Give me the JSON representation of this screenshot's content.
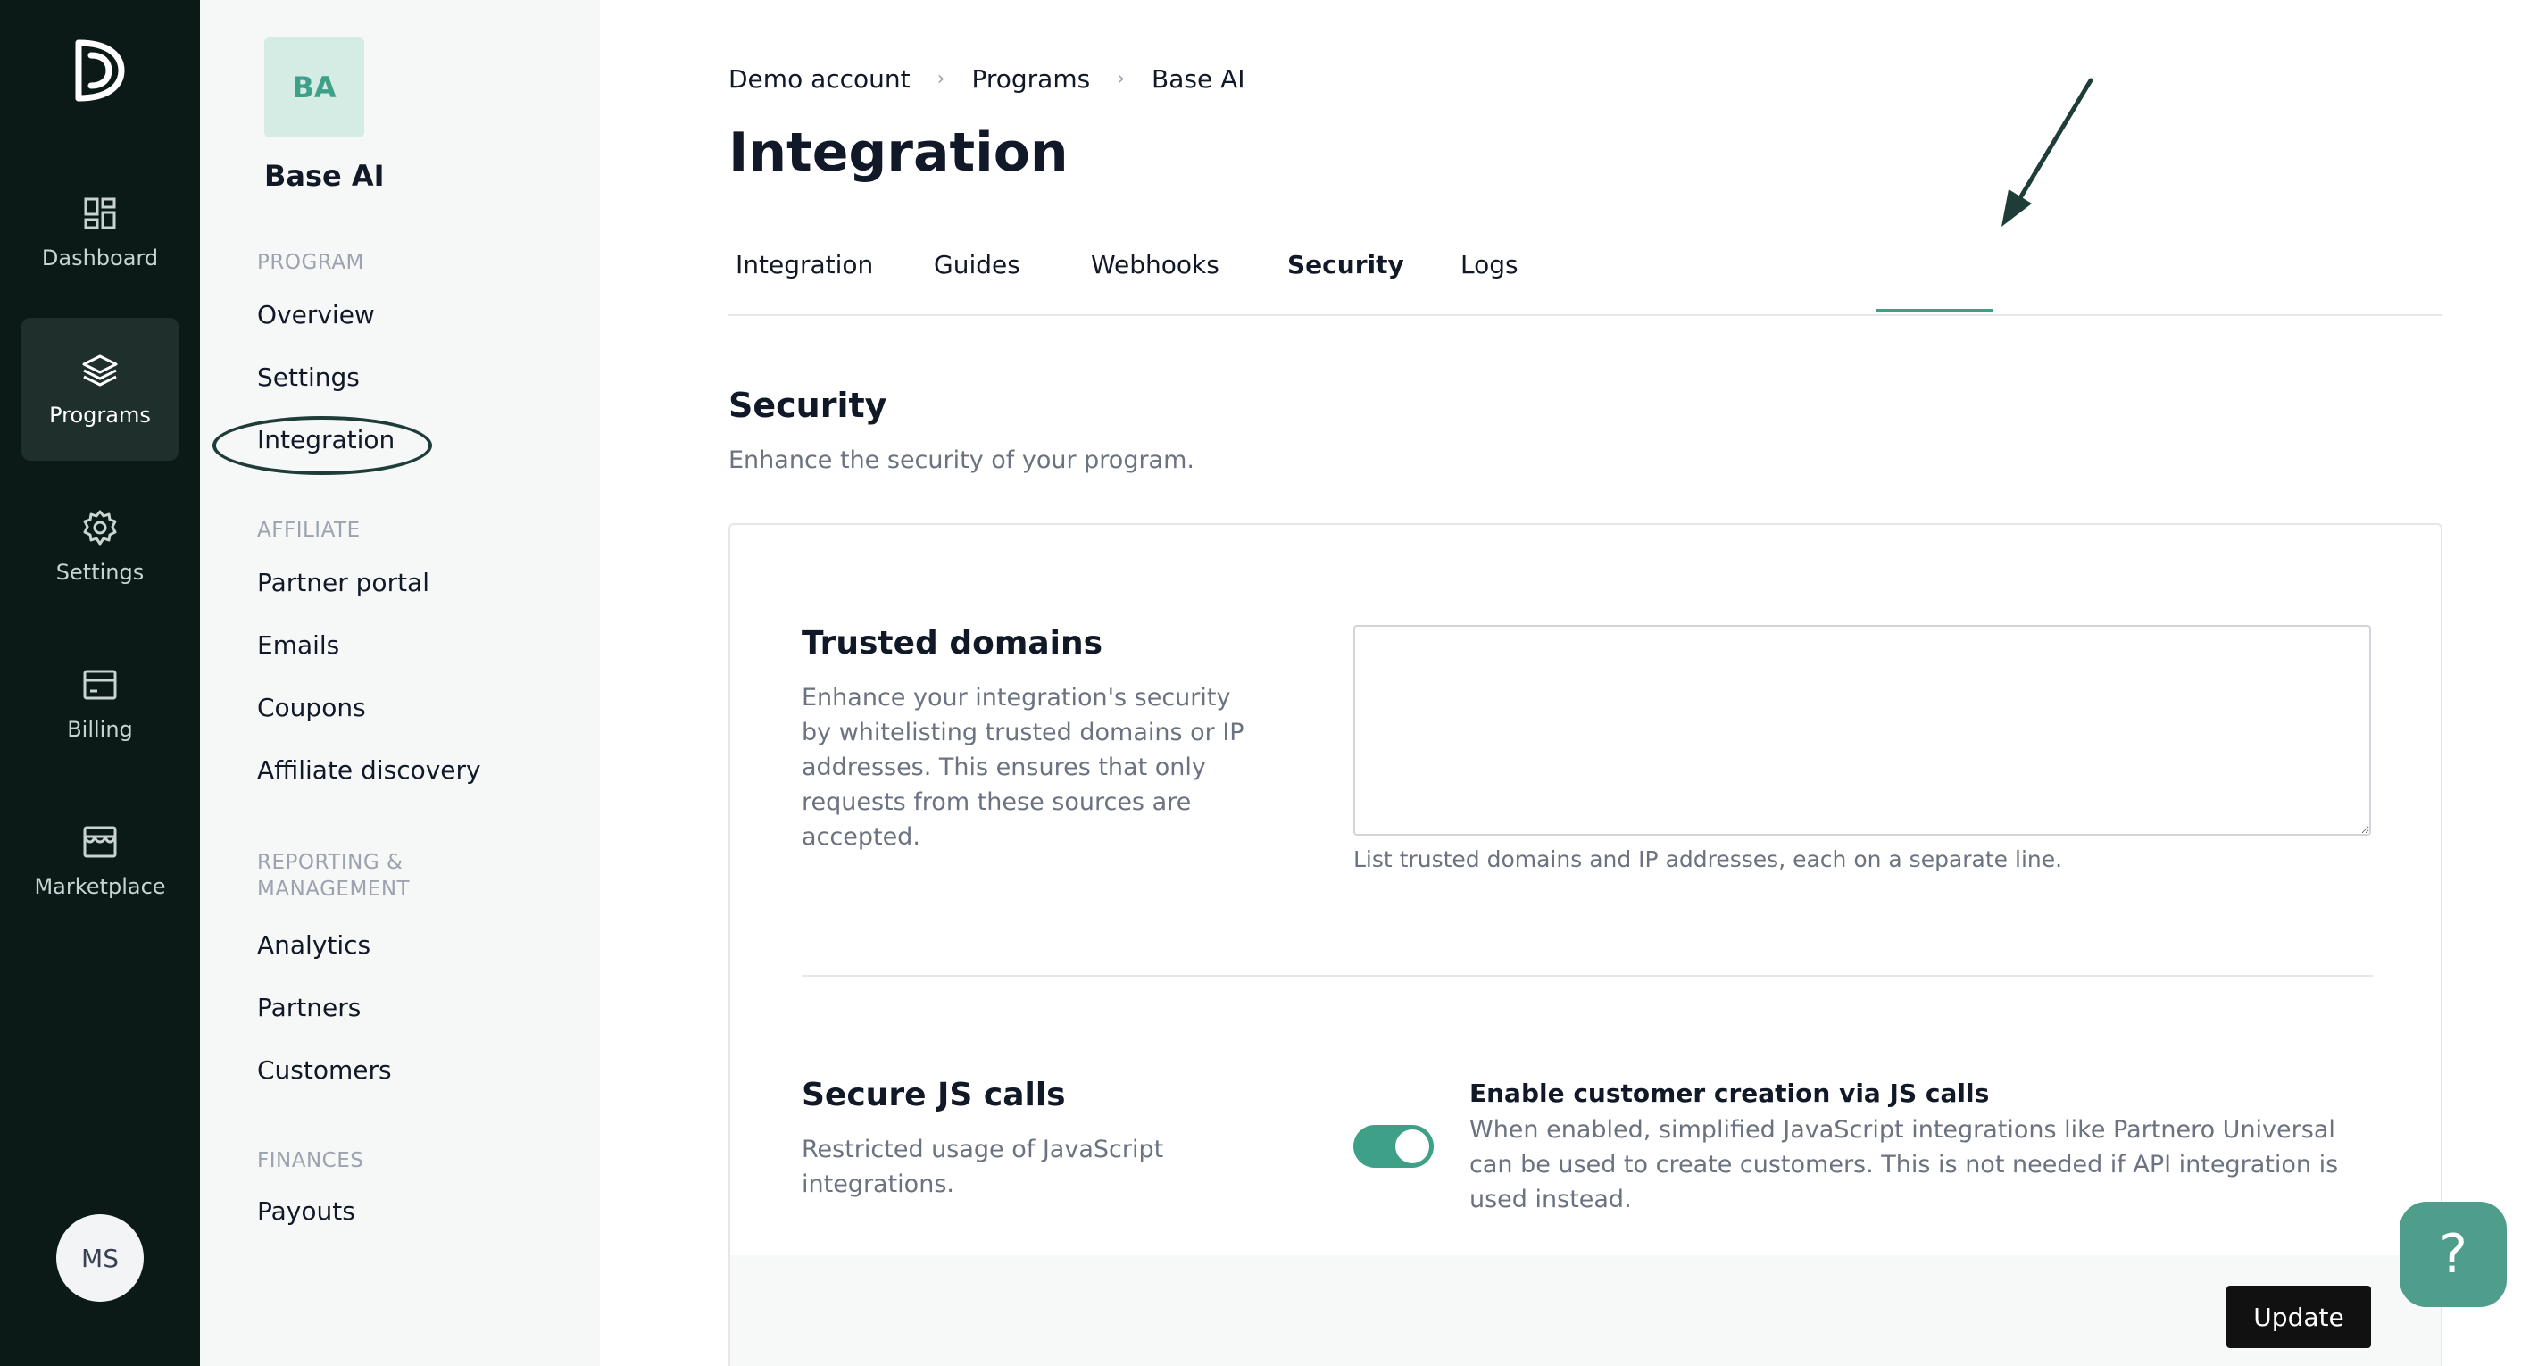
{
  "rail": {
    "items": [
      {
        "label": "Dashboard",
        "icon": "dashboard-icon"
      },
      {
        "label": "Programs",
        "icon": "layers-icon"
      },
      {
        "label": "Settings",
        "icon": "gear-icon"
      },
      {
        "label": "Billing",
        "icon": "billing-icon"
      },
      {
        "label": "Marketplace",
        "icon": "store-icon"
      }
    ],
    "avatar": "MS"
  },
  "sidebar": {
    "badge": "BA",
    "program_name": "Base AI",
    "sections": {
      "program": "PROGRAM",
      "affiliate": "AFFILIATE",
      "reporting_line1": "REPORTING &",
      "reporting_line2": "MANAGEMENT",
      "finances": "FINANCES"
    },
    "links": {
      "overview": "Overview",
      "settings": "Settings",
      "integration": "Integration",
      "partner_portal": "Partner portal",
      "emails": "Emails",
      "coupons": "Coupons",
      "affiliate_discovery": "Affiliate discovery",
      "analytics": "Analytics",
      "partners": "Partners",
      "customers": "Customers",
      "payouts": "Payouts"
    }
  },
  "breadcrumb": [
    "Demo account",
    "Programs",
    "Base AI"
  ],
  "page_title": "Integration",
  "tabs": [
    "Integration",
    "Guides",
    "Webhooks",
    "Security",
    "Logs"
  ],
  "active_tab": "Security",
  "section": {
    "title": "Security",
    "description": "Enhance the security of your program."
  },
  "trusted_domains": {
    "title": "Trusted domains",
    "description": "Enhance your integration's security by whitelisting trusted domains or IP addresses. This ensures that only requests from these sources are accepted.",
    "value": "",
    "hint": "List trusted domains and IP addresses, each on a separate line."
  },
  "secure_js": {
    "title": "Secure JS calls",
    "description": "Restricted usage of JavaScript integrations.",
    "toggle_on": true,
    "option_title": "Enable customer creation via JS calls",
    "option_description": "When enabled, simplified JavaScript integrations like Partnero Universal can be used to create customers. This is not needed if API integration is used instead."
  },
  "update_label": "Update",
  "help_label": "?",
  "colors": {
    "accent": "#3fa088",
    "rail_bg": "#0b1a17",
    "annotation": "#1e3d38"
  }
}
